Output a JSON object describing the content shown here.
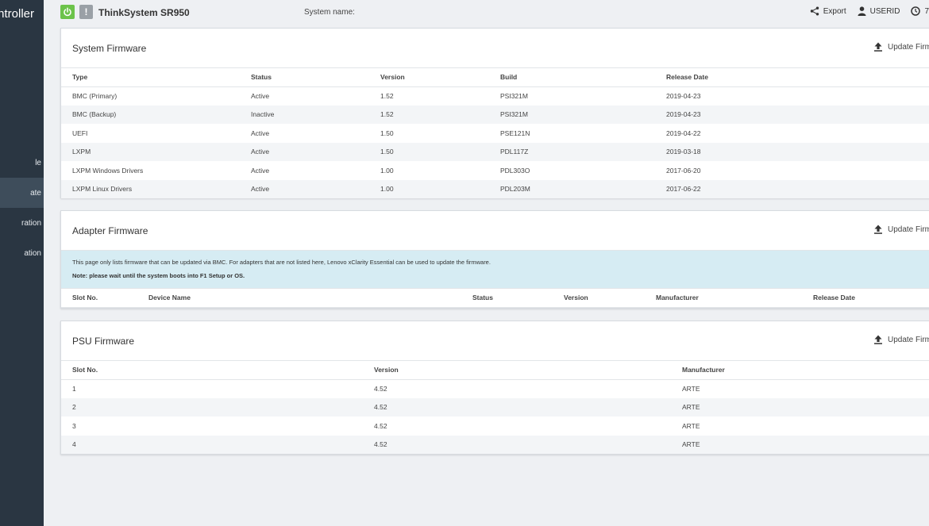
{
  "sidebar": {
    "brand": "ntroller",
    "items": [
      {
        "label": "le",
        "active": false
      },
      {
        "label": "ate",
        "active": true
      },
      {
        "label": "ration",
        "active": false
      },
      {
        "label": "ation",
        "active": false
      }
    ]
  },
  "header": {
    "alert_glyph": "!",
    "product_name": "ThinkSystem SR950",
    "system_name_label": "System name:",
    "export_label": "Export",
    "user_label": "USERID",
    "time_label": "7"
  },
  "system_firmware": {
    "title": "System Firmware",
    "update_label": "Update Firm",
    "columns": [
      "Type",
      "Status",
      "Version",
      "Build",
      "Release Date"
    ],
    "rows": [
      [
        "BMC (Primary)",
        "Active",
        "1.52",
        "PSI321M",
        "2019-04-23"
      ],
      [
        "BMC (Backup)",
        "Inactive",
        "1.52",
        "PSI321M",
        "2019-04-23"
      ],
      [
        "UEFI",
        "Active",
        "1.50",
        "PSE121N",
        "2019-04-22"
      ],
      [
        "LXPM",
        "Active",
        "1.50",
        "PDL117Z",
        "2019-03-18"
      ],
      [
        "LXPM Windows Drivers",
        "Active",
        "1.00",
        "PDL303O",
        "2017-06-20"
      ],
      [
        "LXPM Linux Drivers",
        "Active",
        "1.00",
        "PDL203M",
        "2017-06-22"
      ]
    ]
  },
  "adapter_firmware": {
    "title": "Adapter Firmware",
    "update_label": "Update Firm",
    "info_line1": "This page only lists firmware that can be updated via BMC. For adapters that are not listed here, Lenovo xClarity Essential can be used to update the firmware.",
    "info_line2": "Note: please wait until the system boots into F1 Setup or OS.",
    "columns": [
      "Slot No.",
      "Device Name",
      "Status",
      "Version",
      "Manufacturer",
      "Release Date"
    ]
  },
  "psu_firmware": {
    "title": "PSU Firmware",
    "update_label": "Update Firm",
    "columns": [
      "Slot No.",
      "Version",
      "Manufacturer"
    ],
    "rows": [
      [
        "1",
        "4.52",
        "ARTE"
      ],
      [
        "2",
        "4.52",
        "ARTE"
      ],
      [
        "3",
        "4.52",
        "ARTE"
      ],
      [
        "4",
        "4.52",
        "ARTE"
      ]
    ]
  },
  "colors": {
    "sidebar_bg": "#2a3642",
    "power_green": "#6cc34a",
    "info_blue": "#d6ecf3"
  }
}
